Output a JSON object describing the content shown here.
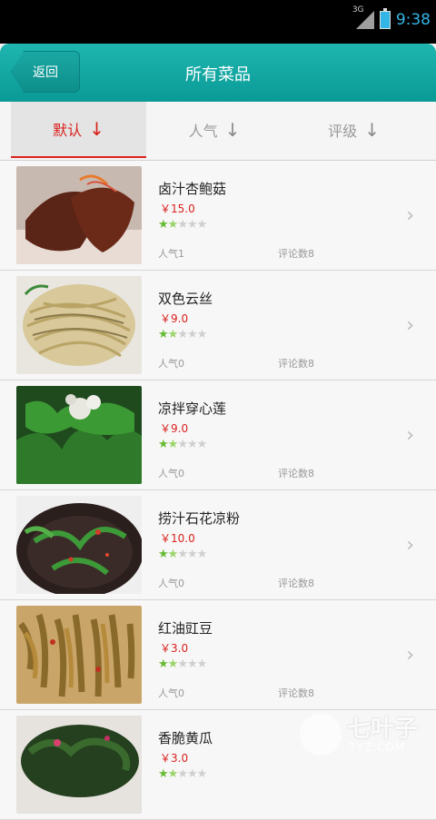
{
  "status_bar": {
    "network": "3G",
    "time": "9:38"
  },
  "header": {
    "back_label": "返回",
    "title": "所有菜品"
  },
  "tabs": [
    {
      "label": "默认",
      "arrow": "↓",
      "active": true
    },
    {
      "label": "人气",
      "arrow": "↓",
      "active": false
    },
    {
      "label": "评级",
      "arrow": "↓",
      "active": false
    }
  ],
  "dishes": [
    {
      "name": "卤汁杏鲍菇",
      "price": "￥15.0",
      "rating": 1.5,
      "popularity": "人气1",
      "reviews": "评论数8",
      "image": "braised-king-oyster-mushroom"
    },
    {
      "name": "双色云丝",
      "price": "￥9.0",
      "rating": 1.5,
      "popularity": "人气0",
      "reviews": "评论数8",
      "image": "two-color-noodle-shreds"
    },
    {
      "name": "凉拌穿心莲",
      "price": "￥9.0",
      "rating": 1.5,
      "popularity": "人气0",
      "reviews": "评论数8",
      "image": "cold-andrographis-salad"
    },
    {
      "name": "捞汁石花凉粉",
      "price": "￥10.0",
      "rating": 1.5,
      "popularity": "人气0",
      "reviews": "评论数8",
      "image": "agar-jelly-with-sauce"
    },
    {
      "name": "红油豇豆",
      "price": "￥3.0",
      "rating": 1.5,
      "popularity": "人气0",
      "reviews": "评论数8",
      "image": "red-oil-cowpeas"
    },
    {
      "name": "香脆黄瓜",
      "price": "￥3.0",
      "rating": 1.5,
      "popularity": "",
      "reviews": "",
      "image": "crispy-cucumber"
    }
  ],
  "watermark": {
    "text": "七叶子",
    "sub": "7YZ.COM"
  },
  "colors": {
    "header": "#0fa8a3",
    "accent_red": "#d9211d",
    "star_green": "#66bb33"
  }
}
